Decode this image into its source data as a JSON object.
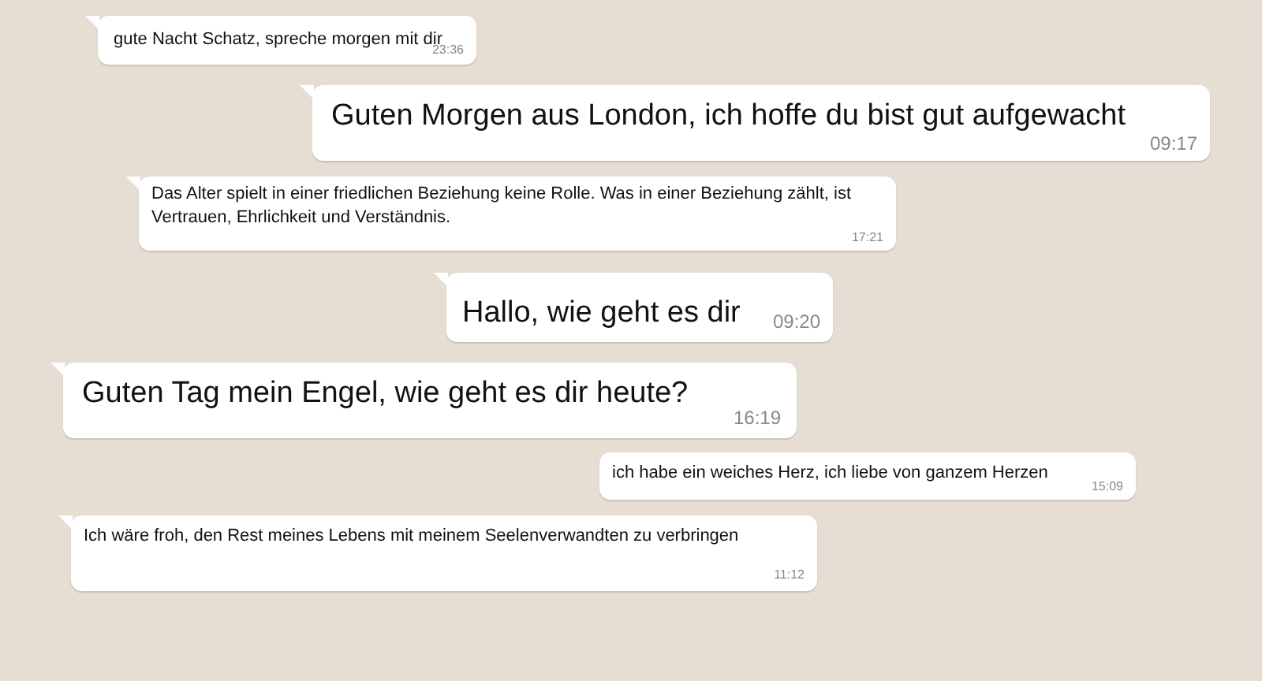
{
  "messages": [
    {
      "text": "gute Nacht Schatz, spreche morgen mit dir",
      "time": "23:36"
    },
    {
      "text": "Guten Morgen aus London, ich hoffe du bist gut aufgewacht",
      "time": "09:17"
    },
    {
      "text": "Das Alter spielt in einer friedlichen Beziehung keine Rolle. Was in einer Beziehung zählt, ist Vertrauen, Ehrlichkeit und Verständnis.",
      "time": "17:21"
    },
    {
      "text": "Hallo, wie geht es dir",
      "time": "09:20"
    },
    {
      "text": "Guten Tag mein Engel, wie geht es dir heute?",
      "time": "16:19"
    },
    {
      "text": "ich habe ein weiches Herz, ich liebe von ganzem Herzen",
      "time": "15:09"
    },
    {
      "text": "Ich wäre froh, den Rest meines Lebens mit meinem Seelenverwandten zu verbringen",
      "time": "11:12"
    }
  ]
}
